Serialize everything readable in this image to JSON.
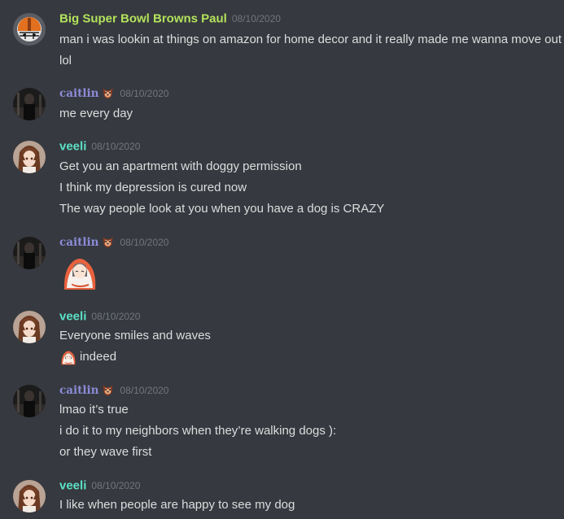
{
  "colors": {
    "background": "#36393f",
    "text": "#dcddde",
    "timestamp": "#72767d",
    "paul_name": "#b3e35c",
    "caitlin_name": "#8b8bd8",
    "veeli_name": "#5ce0c6"
  },
  "messages": [
    {
      "author": "Big Super Bowl Browns Paul",
      "timestamp": "08/10/2020",
      "avatar_icon": "football-helmet-avatar",
      "lines": [
        "man i was lookin at things on amazon for home decor and it really made me wanna move out",
        "lol"
      ]
    },
    {
      "author": "caitlin",
      "badge_icon": "dog-face-badge",
      "timestamp": "08/10/2020",
      "avatar_icon": "dark-figure-avatar",
      "lines": [
        "me every day"
      ]
    },
    {
      "author": "veeli",
      "timestamp": "08/10/2020",
      "avatar_icon": "anime-girl-avatar",
      "lines": [
        "Get you an apartment with doggy permission",
        "I think my depression is cured now",
        "The way people look at you when you have a dog is CRAZY"
      ]
    },
    {
      "author": "caitlin",
      "badge_icon": "dog-face-badge",
      "timestamp": "08/10/2020",
      "avatar_icon": "dark-figure-avatar",
      "sticker_icon": "blanket-girl-sticker"
    },
    {
      "author": "veeli",
      "timestamp": "08/10/2020",
      "avatar_icon": "anime-girl-avatar",
      "lines": [
        "Everyone smiles and waves",
        "indeed"
      ],
      "inline_emoji": "blanket-girl-emoji"
    },
    {
      "author": "caitlin",
      "badge_icon": "dog-face-badge",
      "timestamp": "08/10/2020",
      "avatar_icon": "dark-figure-avatar",
      "lines": [
        "lmao it’s true",
        "i do it to my neighbors when they’re walking dogs ):",
        "or they wave first"
      ]
    },
    {
      "author": "veeli",
      "timestamp": "08/10/2020",
      "avatar_icon": "anime-girl-avatar",
      "lines": [
        "I like when people are happy to see my dog"
      ]
    }
  ]
}
